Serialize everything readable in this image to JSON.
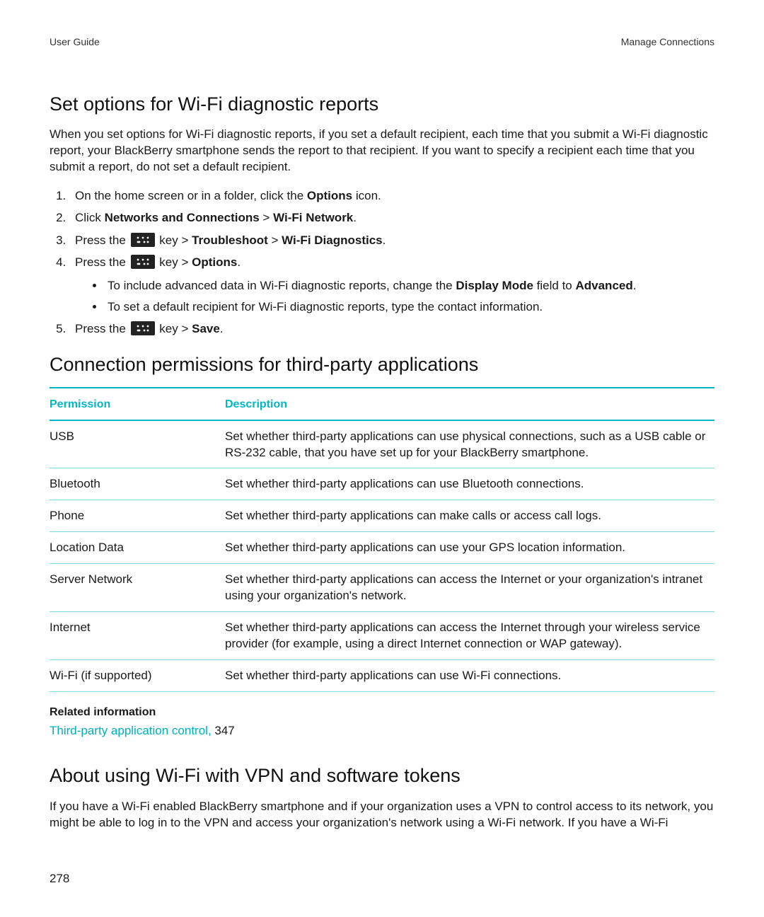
{
  "header": {
    "left": "User Guide",
    "right": "Manage Connections"
  },
  "section1": {
    "title": "Set options for Wi-Fi diagnostic reports",
    "intro": "When you set options for Wi-Fi diagnostic reports, if you set a default recipient, each time that you submit a Wi-Fi diagnostic report, your BlackBerry smartphone sends the report to that recipient. If you want to specify a recipient each time that you submit a report, do not set a default recipient.",
    "steps": {
      "s1_a": "On the home screen or in a folder, click the ",
      "s1_b": "Options",
      "s1_c": " icon.",
      "s2_a": "Click ",
      "s2_b": "Networks and Connections",
      "s2_c": " > ",
      "s2_d": "Wi-Fi Network",
      "s2_e": ".",
      "s3_a": "Press the ",
      "s3_b": " key > ",
      "s3_c": "Troubleshoot",
      "s3_d": " > ",
      "s3_e": "Wi-Fi Diagnostics",
      "s3_f": ".",
      "s4_a": "Press the ",
      "s4_b": " key > ",
      "s4_c": "Options",
      "s4_d": ".",
      "sub1_a": "To include advanced data in Wi-Fi diagnostic reports, change the ",
      "sub1_b": "Display Mode",
      "sub1_c": " field to ",
      "sub1_d": "Advanced",
      "sub1_e": ".",
      "sub2": "To set a default recipient for Wi-Fi diagnostic reports, type the contact information.",
      "s5_a": "Press the ",
      "s5_b": " key > ",
      "s5_c": "Save",
      "s5_d": "."
    }
  },
  "section2": {
    "title": "Connection permissions for third-party applications",
    "headers": {
      "perm": "Permission",
      "desc": "Description"
    },
    "rows": [
      {
        "perm": "USB",
        "desc": "Set whether third-party applications can use physical connections, such as a USB cable or RS-232 cable, that you have set up for your BlackBerry smartphone."
      },
      {
        "perm": "Bluetooth",
        "desc": "Set whether third-party applications can use Bluetooth connections."
      },
      {
        "perm": "Phone",
        "desc": "Set whether third-party applications can make calls or access call logs."
      },
      {
        "perm": "Location Data",
        "desc": "Set whether third-party applications can use your GPS location information."
      },
      {
        "perm": "Server Network",
        "desc": "Set whether third-party applications can access the Internet or your organization's intranet using your organization's network."
      },
      {
        "perm": "Internet",
        "desc": "Set whether third-party applications can access the Internet through your wireless service provider (for example, using a direct Internet connection or WAP gateway)."
      },
      {
        "perm": "Wi-Fi (if supported)",
        "desc": "Set whether third-party applications can use Wi-Fi connections."
      }
    ],
    "related": {
      "heading": "Related information",
      "link_text": "Third-party application control, ",
      "link_page": "347"
    }
  },
  "section3": {
    "title": "About using Wi-Fi with VPN and software tokens",
    "body": "If you have a Wi-Fi enabled BlackBerry smartphone and if your organization uses a VPN to control access to its network, you might be able to log in to the VPN and access your organization's network using a Wi-Fi network. If you have a Wi-Fi"
  },
  "page_number": "278"
}
